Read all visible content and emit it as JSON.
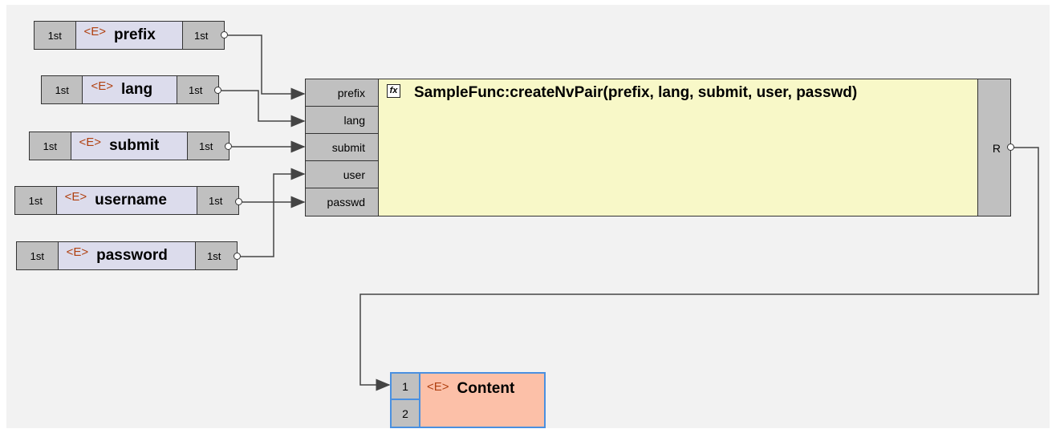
{
  "colors": {
    "canvas": "#f2f2f2",
    "seq_cell": "#c0c0c0",
    "element_body": "#dcdcec",
    "function_body": "#f8f8c8",
    "target_body": "#fcc0a8",
    "target_border": "#4a90e0",
    "element_tag": "#b04010",
    "wire": "#444444"
  },
  "element_tag": "<E>",
  "source_nodes": [
    {
      "name": "prefix",
      "in_seq": "1st",
      "out_seq": "1st"
    },
    {
      "name": "lang",
      "in_seq": "1st",
      "out_seq": "1st"
    },
    {
      "name": "submit",
      "in_seq": "1st",
      "out_seq": "1st"
    },
    {
      "name": "username",
      "in_seq": "1st",
      "out_seq": "1st"
    },
    {
      "name": "password",
      "in_seq": "1st",
      "out_seq": "1st"
    }
  ],
  "function": {
    "icon": "function-icon",
    "icon_glyph": "fx",
    "title": "SampleFunc:createNvPair(prefix, lang, submit, user, passwd)",
    "ports": [
      "prefix",
      "lang",
      "submit",
      "user",
      "passwd"
    ],
    "result_label": "R"
  },
  "target": {
    "name": "Content",
    "ports": [
      "1",
      "2"
    ]
  }
}
